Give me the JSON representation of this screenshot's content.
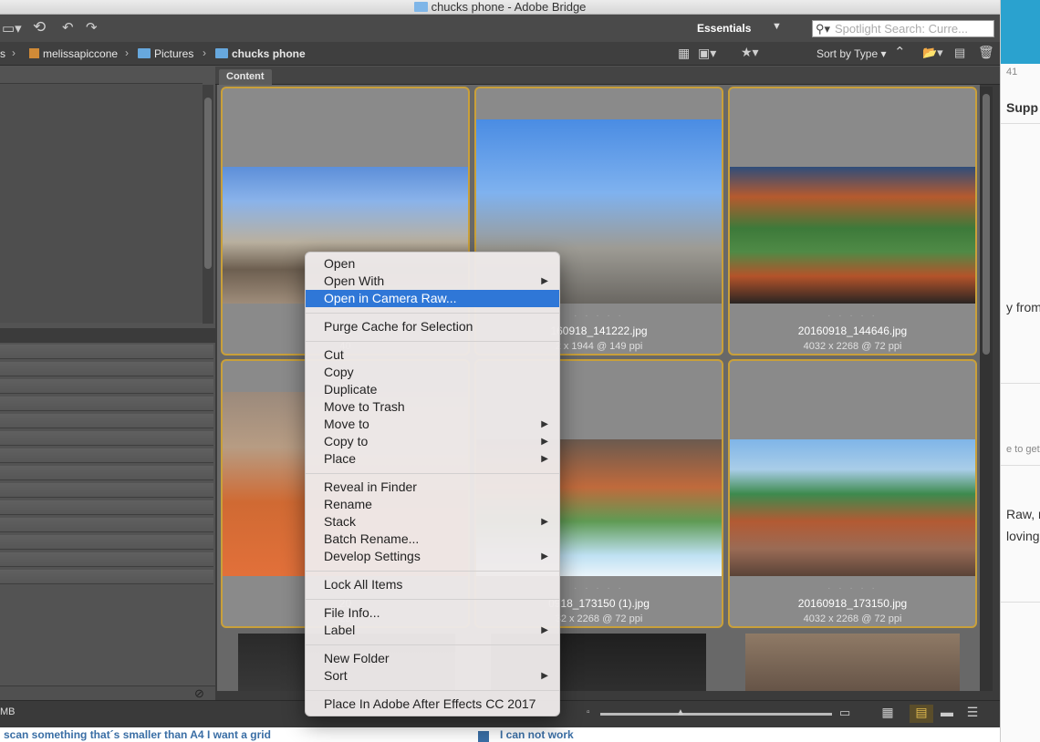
{
  "window": {
    "title": "chucks phone - Adobe Bridge"
  },
  "toolbar": {
    "workspace": "Essentials",
    "search_placeholder": "Spotlight Search: Curre..."
  },
  "path": {
    "items": [
      "s",
      "melissapiccone",
      "Pictures",
      "chucks phone"
    ]
  },
  "sort": {
    "label": "Sort by Type"
  },
  "content_tab": "Content",
  "thumbs": [
    {
      "name": "20",
      "meta": "40"
    },
    {
      "name": "160918_141222.jpg",
      "meta": "2 x 1944 @ 149 ppi"
    },
    {
      "name": "20160918_144646.jpg",
      "meta": "4032 x 2268 @ 72 ppi"
    },
    {
      "name": "20",
      "meta": "25"
    },
    {
      "name": "0918_173150 (1).jpg",
      "meta": "32 x 2268 @ 72 ppi"
    },
    {
      "name": "20160918_173150.jpg",
      "meta": "4032 x 2268 @ 72 ppi"
    }
  ],
  "status": {
    "text": "MB"
  },
  "context_menu": {
    "groups": [
      [
        {
          "label": "Open",
          "sub": false
        },
        {
          "label": "Open With",
          "sub": true
        },
        {
          "label": "Open in Camera Raw...",
          "sub": false,
          "selected": true
        }
      ],
      [
        {
          "label": "Purge Cache for Selection",
          "sub": false
        }
      ],
      [
        {
          "label": "Cut",
          "sub": false
        },
        {
          "label": "Copy",
          "sub": false
        },
        {
          "label": "Duplicate",
          "sub": false
        },
        {
          "label": "Move to Trash",
          "sub": false
        },
        {
          "label": "Move to",
          "sub": true
        },
        {
          "label": "Copy to",
          "sub": true
        },
        {
          "label": "Place",
          "sub": true
        }
      ],
      [
        {
          "label": "Reveal in Finder",
          "sub": false
        },
        {
          "label": "Rename",
          "sub": false
        },
        {
          "label": "Stack",
          "sub": true
        },
        {
          "label": "Batch Rename...",
          "sub": false
        },
        {
          "label": "Develop Settings",
          "sub": true
        }
      ],
      [
        {
          "label": "Lock All Items",
          "sub": false
        }
      ],
      [
        {
          "label": "File Info...",
          "sub": false
        },
        {
          "label": "Label",
          "sub": true
        }
      ],
      [
        {
          "label": "New Folder",
          "sub": false
        },
        {
          "label": "Sort",
          "sub": true
        }
      ],
      [
        {
          "label": "Place In Adobe After Effects CC 2017",
          "sub": false
        }
      ]
    ]
  },
  "background_page": {
    "bits": [
      "41",
      "Supp",
      "y from",
      "e to getti",
      "Raw, no",
      "loving t"
    ]
  },
  "background_forum": {
    "left_link": "scan something that´s smaller than A4 I want a grid",
    "right_link": "I can not work"
  }
}
